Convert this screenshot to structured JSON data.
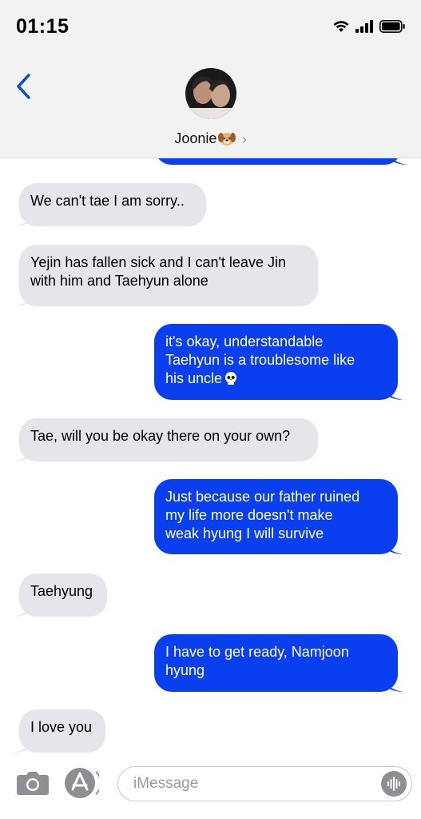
{
  "status_bar": {
    "time": "01:15"
  },
  "header": {
    "contact_name": "Joonie",
    "contact_emoji": "dog-face-icon"
  },
  "messages": [
    {
      "from": "me",
      "text": ""
    },
    {
      "from": "them",
      "text": "We can't tae I am sorry.."
    },
    {
      "from": "them",
      "lines": [
        "Yejin has fallen sick and I can't leave Jin",
        "with him and Taehyun alone"
      ]
    },
    {
      "from": "me",
      "lines": [
        "it's okay, understandable",
        "Taehyun is a troublesome like",
        "his uncle"
      ],
      "emoji": "skull-icon"
    },
    {
      "from": "them",
      "text": "Tae, will you be okay there on your own?"
    },
    {
      "from": "me",
      "lines": [
        "Just because our father ruined",
        "my life more doesn't make",
        "weak hyung I will survive"
      ]
    },
    {
      "from": "them",
      "text": "Taehyung"
    },
    {
      "from": "me",
      "lines": [
        "I have to get ready, Namjoon",
        "hyung"
      ]
    },
    {
      "from": "them",
      "text": "I love you"
    }
  ],
  "composer": {
    "placeholder": "iMessage"
  },
  "colors": {
    "outgoing": "#0a3ff0",
    "incoming": "#e5e5ea",
    "accent": "#0a52c9"
  }
}
